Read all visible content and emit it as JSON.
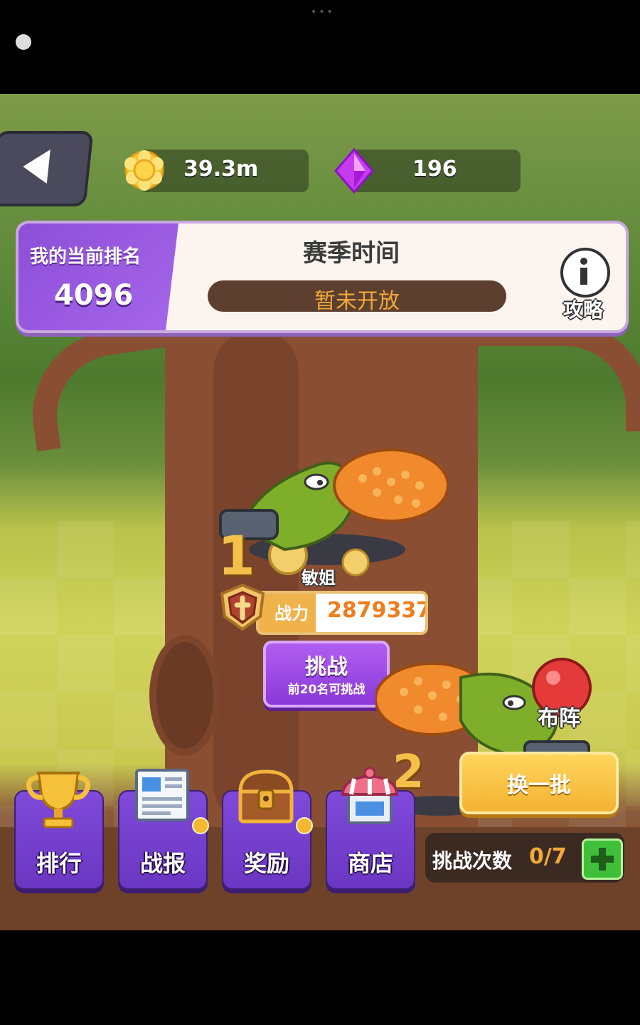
{
  "resources": {
    "coins": "39.3m",
    "gems": "196"
  },
  "rank_panel": {
    "title": "我的当前排名",
    "value": "4096"
  },
  "season": {
    "title": "赛季时间",
    "status": "暂未开放"
  },
  "guide": {
    "label": "攻略"
  },
  "opponent_1": {
    "rank": "1",
    "name": "敏姐",
    "power_label": "战力",
    "power_value": "2879337"
  },
  "challenge": {
    "label": "挑战",
    "sub": "前20名可挑战"
  },
  "opponent_2": {
    "rank": "2"
  },
  "lineup_label": "布阵",
  "swap_label": "换一批",
  "menu": [
    {
      "label": "排行",
      "icon": "trophy-icon",
      "badge": false
    },
    {
      "label": "战报",
      "icon": "newspaper-icon",
      "badge": true
    },
    {
      "label": "奖励",
      "icon": "treasure-chest-icon",
      "badge": true
    },
    {
      "label": "商店",
      "icon": "shop-icon",
      "badge": false
    }
  ],
  "challenge_count": {
    "label": "挑战次数",
    "value": "0/7"
  },
  "colors": {
    "purple": "#8a38d8",
    "gold": "#f3b232",
    "orange_text": "#f2a83a",
    "green_plus": "#3fbf3a"
  }
}
